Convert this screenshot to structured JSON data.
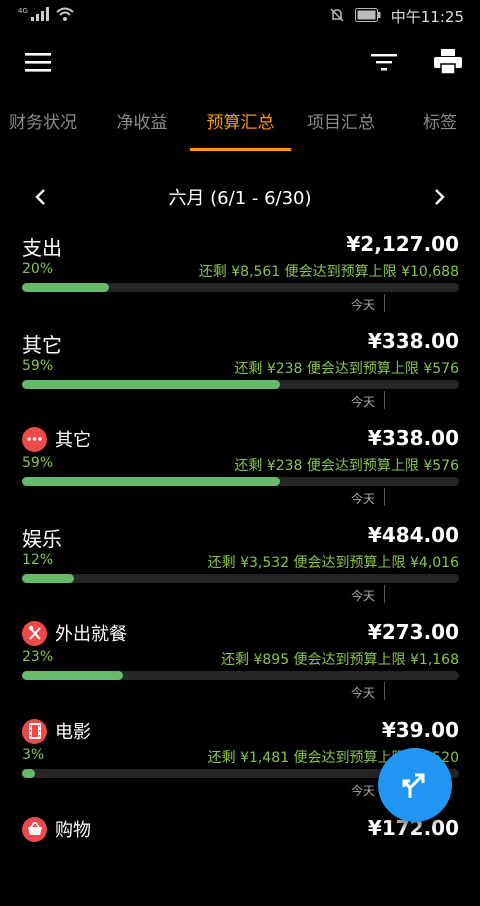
{
  "statusbar": {
    "network": "4G",
    "time": "中午11:25"
  },
  "tabs": [
    "财务状况",
    "净收益",
    "预算汇总",
    "项目汇总",
    "标签"
  ],
  "active_tab": 2,
  "month_label": "六月 (6/1 - 6/30)",
  "rows": [
    {
      "title": "支出",
      "amount": "¥2,127.00",
      "percent": "20%",
      "fill": 0.2,
      "remaining": "还剩 ¥8,561 便会达到预算上限 ¥10,688",
      "today": "今天",
      "icon": null
    },
    {
      "title": "其它",
      "amount": "¥338.00",
      "percent": "59%",
      "fill": 0.59,
      "remaining": "还剩 ¥238 便会达到预算上限 ¥576",
      "today": "今天",
      "icon": null
    },
    {
      "title": "其它",
      "amount": "¥338.00",
      "percent": "59%",
      "fill": 0.59,
      "remaining": "还剩 ¥238 便会达到预算上限 ¥576",
      "today": "今天",
      "icon": "more-dots-icon"
    },
    {
      "title": "娱乐",
      "amount": "¥484.00",
      "percent": "12%",
      "fill": 0.12,
      "remaining": "还剩 ¥3,532 便会达到预算上限 ¥4,016",
      "today": "今天",
      "icon": null
    },
    {
      "title": "外出就餐",
      "amount": "¥273.00",
      "percent": "23%",
      "fill": 0.23,
      "remaining": "还剩 ¥895 便会达到预算上限 ¥1,168",
      "today": "今天",
      "icon": "fork-knife-icon"
    },
    {
      "title": "电影",
      "amount": "¥39.00",
      "percent": "3%",
      "fill": 0.03,
      "remaining": "还剩 ¥1,481 便会达到预算上限 ¥1,520",
      "today": "今天",
      "icon": "film-icon"
    },
    {
      "title": "购物",
      "amount": "¥172.00",
      "percent": "",
      "fill": 0.11,
      "remaining": "",
      "today": "",
      "icon": "basket-icon"
    }
  ],
  "colors": {
    "accent": "#FF9800",
    "progress": "#66bb6a",
    "text_green": "#8bc34a",
    "icon_bg": "#ef4a4a",
    "fab": "#2196F3"
  }
}
